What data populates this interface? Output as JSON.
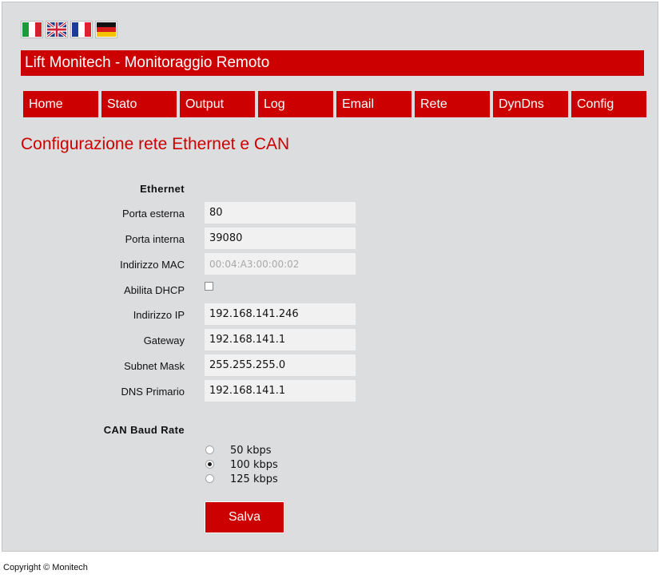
{
  "flags": [
    {
      "icon": "flag-italy-icon"
    },
    {
      "icon": "flag-uk-icon"
    },
    {
      "icon": "flag-france-icon"
    },
    {
      "icon": "flag-germany-icon"
    }
  ],
  "header": {
    "title": "Lift Monitech - Monitoraggio Remoto"
  },
  "nav": {
    "items": [
      {
        "label": "Home"
      },
      {
        "label": "Stato"
      },
      {
        "label": "Output"
      },
      {
        "label": "Log"
      },
      {
        "label": "Email"
      },
      {
        "label": "Rete"
      },
      {
        "label": "DynDns"
      },
      {
        "label": "Config"
      }
    ]
  },
  "page": {
    "title": "Configurazione rete Ethernet e CAN"
  },
  "ethernet": {
    "heading": "Ethernet",
    "porta_esterna_label": "Porta esterna",
    "porta_esterna_value": "80",
    "porta_interna_label": "Porta interna",
    "porta_interna_value": "39080",
    "mac_label": "Indirizzo MAC",
    "mac_value": "00:04:A3:00:00:02",
    "dhcp_label": "Abilita DHCP",
    "dhcp_checked": false,
    "ip_label": "Indirizzo IP",
    "ip_value": "192.168.141.246",
    "gateway_label": "Gateway",
    "gateway_value": "192.168.141.1",
    "subnet_label": "Subnet Mask",
    "subnet_value": "255.255.255.0",
    "dns_label": "DNS Primario",
    "dns_value": "192.168.141.1"
  },
  "can": {
    "heading": "CAN Baud Rate",
    "options": [
      {
        "label": "50 kbps",
        "checked": false
      },
      {
        "label": "100 kbps",
        "checked": true
      },
      {
        "label": "125 kbps",
        "checked": false
      }
    ]
  },
  "actions": {
    "save_label": "Salva"
  },
  "footer": {
    "copyright": "Copyright © Monitech"
  },
  "colors": {
    "accent": "#cc0000",
    "panel_bg": "#dcdddf",
    "field_bg": "#f1f1f1"
  }
}
